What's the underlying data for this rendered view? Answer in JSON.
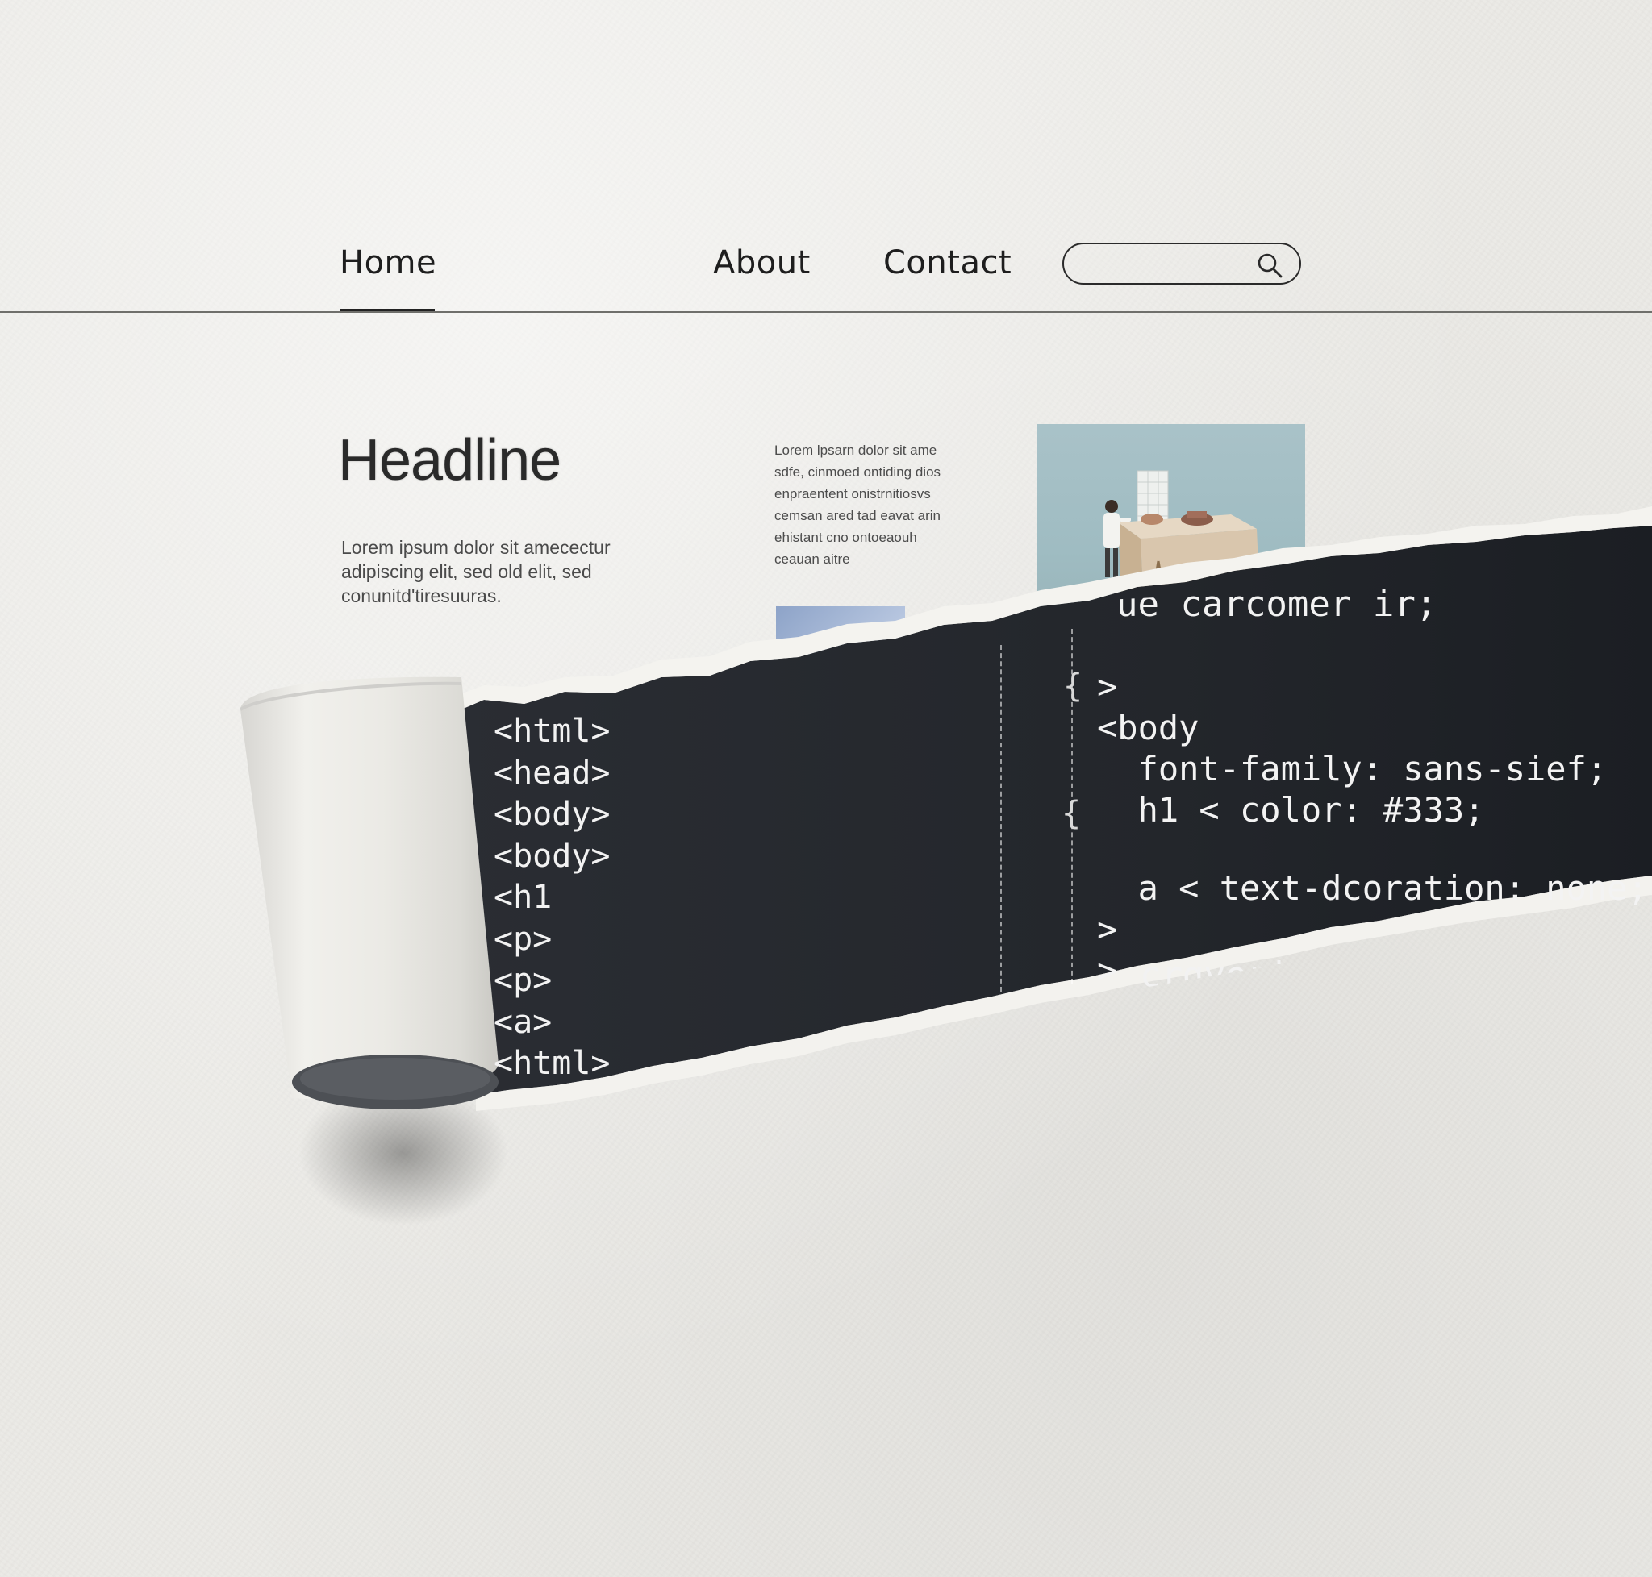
{
  "nav": {
    "links": [
      {
        "label": "Home",
        "active": true
      },
      {
        "label": "About",
        "active": false
      },
      {
        "label": "Contact",
        "active": false
      }
    ],
    "search": {
      "value": "",
      "placeholder": "",
      "icon": "search-icon"
    }
  },
  "content": {
    "headline": "Headline",
    "body_text": "Lorem ipsum dolor sit amecectur adipiscing elit, sed old elit, sed conunitd'tiresuuras.",
    "small_text": "Lorem lpsarn dolor sit ame sdfe, cinmoed ontiding dios enpraentent onistrnitiosvs cemsan ared tad eavat arin ehistant cno ontoeaouh ceauan aitre"
  },
  "code": {
    "html_lines": [
      "<html>",
      "<head>",
      "<body>",
      "<body>",
      "<h1",
      "<p>",
      "<p>",
      "<a>",
      "<html>"
    ],
    "css_partial_top": "ue carcomer ir;",
    "css_lines": [
      ">",
      "<body",
      "  font-family: sans-sief;",
      "  h1 < color: #333;",
      "",
      "  a < text-dcoration: none;",
      ">",
      ">"
    ],
    "css_partial_bottom": "  crgveri",
    "braces": [
      "{",
      "{"
    ]
  },
  "colors": {
    "paper": "#ebeae6",
    "code_background": "#24272c",
    "code_text": "#f2f2f2",
    "text": "#1e1e1e"
  }
}
